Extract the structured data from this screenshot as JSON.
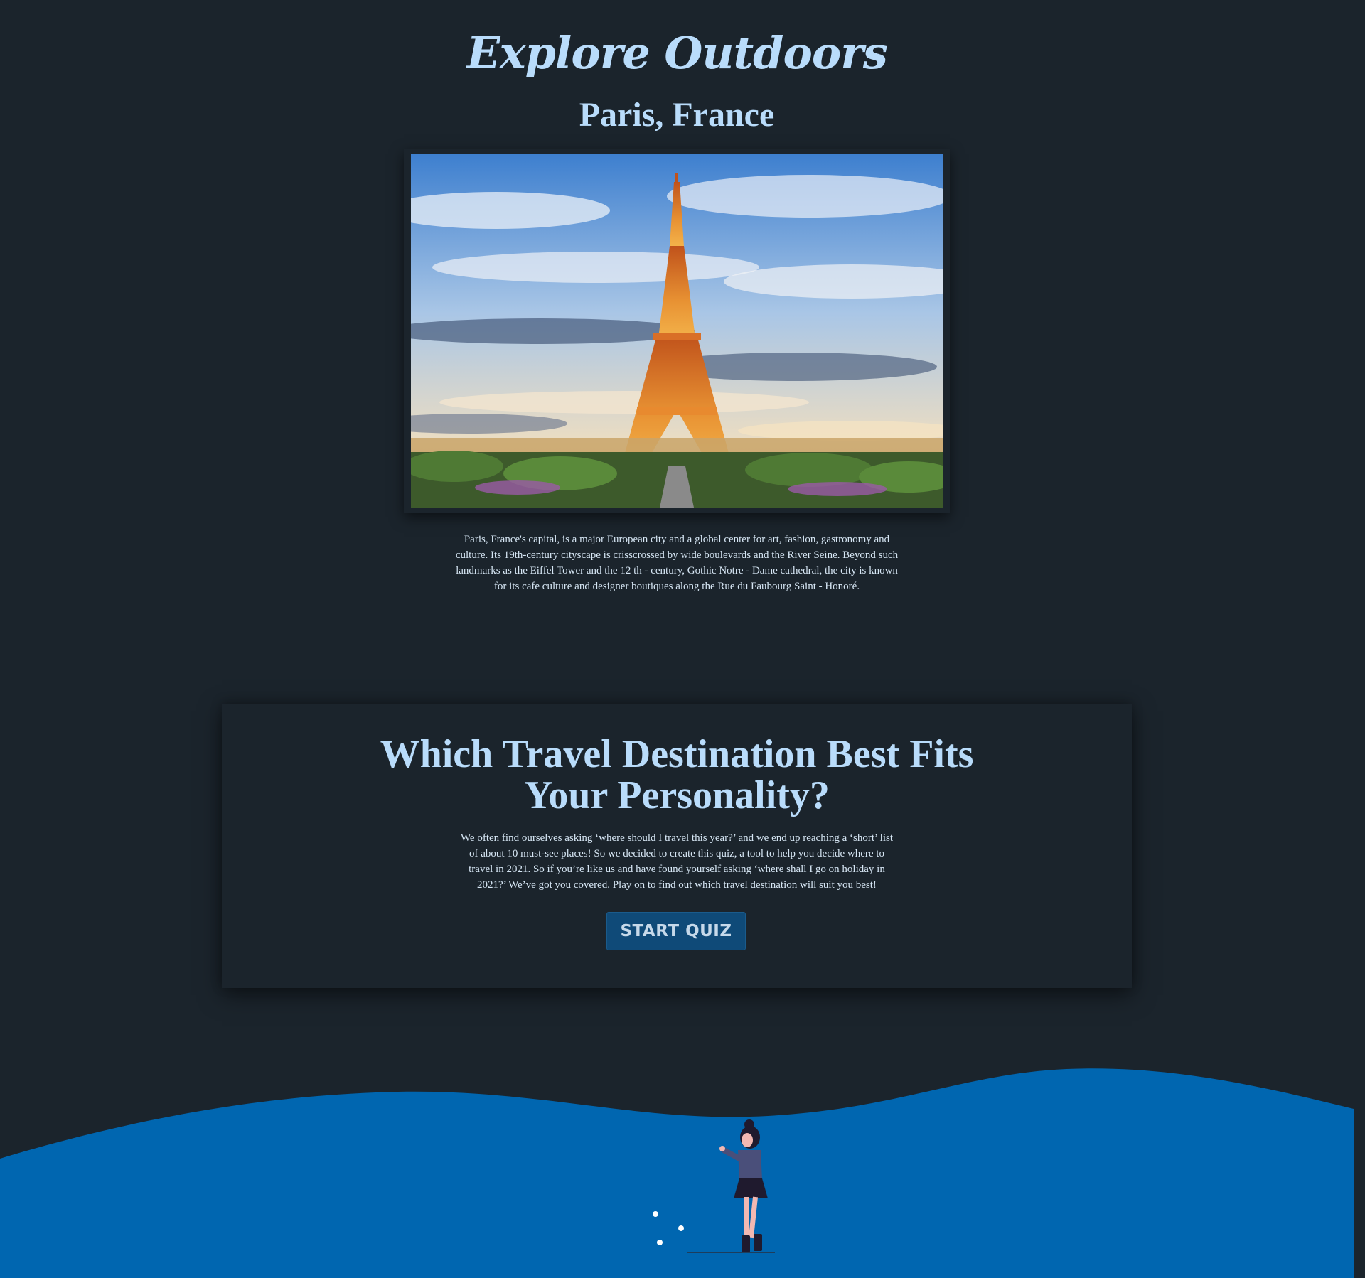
{
  "header": {
    "site_title": "Explore Outdoors",
    "city_title": "Paris, France"
  },
  "hero": {
    "image_icon": "eiffel-tower-photo"
  },
  "city": {
    "description": "Paris, France's capital, is a major European city and a global center for art, fashion, gastronomy and culture. Its 19th-century cityscape is crisscrossed by wide boulevards and the River Seine. Beyond such landmarks as the Eiffel Tower and the 12 th - century, Gothic Notre - Dame cathedral, the city is known for its cafe culture and designer boutiques along the Rue du Faubourg Saint - Honoré."
  },
  "quiz": {
    "title": "Which Travel Destination Best Fits Your Personality?",
    "description": "We often find ourselves asking ‘where should I travel this year?’ and we end up reaching a ‘short’ list of about 10 must-see places! So we decided to create this quiz, a tool to help you decide where to travel in 2021. So if you’re like us and have found yourself asking ‘where shall I go on holiday in 2021?’ We’ve got you covered. Play on to find out which travel destination will suit you best!",
    "start_label": "START QUIZ"
  },
  "colors": {
    "background": "#1b242c",
    "accent_text": "#b9dcfb",
    "button": "#0f4a78",
    "wave": "#0066b0"
  }
}
